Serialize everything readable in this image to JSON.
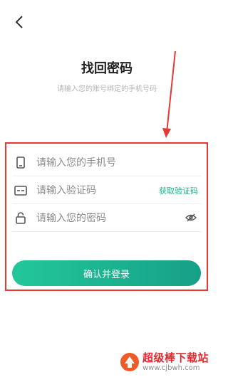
{
  "header": {
    "back_icon": "chevron-left-icon",
    "title": "找回密码",
    "subtitle": "请输入您的账号绑定的手机号码"
  },
  "form": {
    "phone": {
      "placeholder": "请输入您的手机号",
      "value": "",
      "icon": "phone-icon"
    },
    "code": {
      "placeholder": "请输入验证码",
      "value": "",
      "icon": "code-card-icon",
      "action_label": "获取验证码"
    },
    "password": {
      "placeholder": "请输入您的密码",
      "value": "",
      "icon": "lock-icon",
      "toggle_icon": "eye-off-icon"
    },
    "submit_label": "确认并登录"
  },
  "colors": {
    "accent": "#1fb58f",
    "button_gradient_start": "#22c79a",
    "button_gradient_end": "#17a088",
    "annotation_red": "#e53935"
  },
  "watermark": {
    "name": "超级棒下载站",
    "url": "www.cjbwh.com"
  }
}
